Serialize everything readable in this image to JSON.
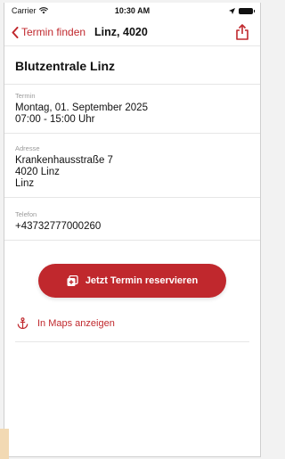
{
  "status_bar": {
    "carrier": "Carrier",
    "time": "10:30 AM"
  },
  "nav": {
    "back_label": "Termin finden",
    "title": "Linz, 4020"
  },
  "venue": {
    "name": "Blutzentrale Linz"
  },
  "termin": {
    "label": "Termin",
    "date": "Montag, 01. September 2025",
    "time": "07:00 - 15:00 Uhr"
  },
  "address": {
    "label": "Adresse",
    "street": "Krankenhausstraße 7",
    "zip_city": "4020 Linz",
    "city": "Linz"
  },
  "phone": {
    "label": "Telefon",
    "number": "+43732777000260"
  },
  "actions": {
    "reserve_label": "Jetzt Termin reservieren",
    "maps_label": "In Maps anzeigen"
  },
  "colors": {
    "accent": "#c0282d"
  },
  "icons": {
    "back": "chevron-left-icon",
    "share": "share-icon",
    "reserve": "calendar-add-icon",
    "maps": "anchor-icon",
    "wifi": "wifi-icon",
    "battery": "battery-icon"
  }
}
